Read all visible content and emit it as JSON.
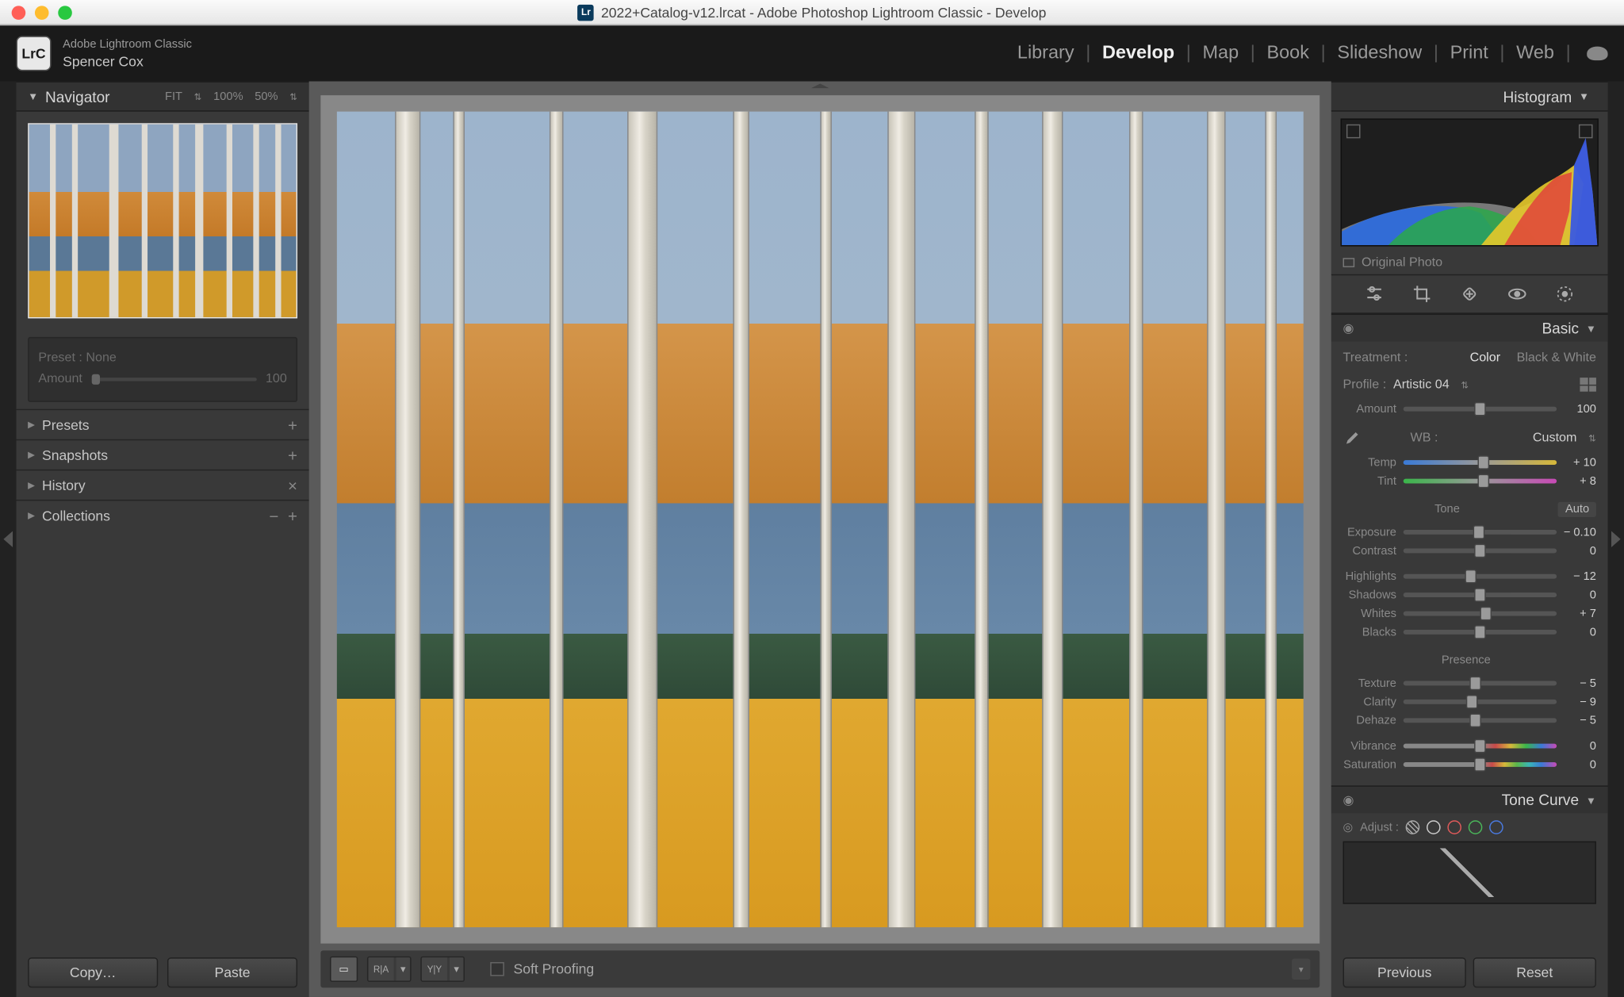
{
  "window": {
    "title": "2022+Catalog-v12.lrcat - Adobe Photoshop Lightroom Classic - Develop"
  },
  "header": {
    "app_name": "Adobe Lightroom Classic",
    "user_name": "Spencer Cox",
    "logo_text": "LrC",
    "modules": [
      "Library",
      "Develop",
      "Map",
      "Book",
      "Slideshow",
      "Print",
      "Web"
    ],
    "active_module": "Develop"
  },
  "left": {
    "navigator": {
      "title": "Navigator",
      "zoom_fit": "FIT",
      "zoom_100": "100%",
      "zoom_50": "50%"
    },
    "preset_box": {
      "preset_label": "Preset : None",
      "amount_label": "Amount",
      "amount_value": "100"
    },
    "sections": [
      {
        "label": "Presets",
        "actions": [
          "+"
        ]
      },
      {
        "label": "Snapshots",
        "actions": [
          "+"
        ]
      },
      {
        "label": "History",
        "actions": [
          "×"
        ]
      },
      {
        "label": "Collections",
        "actions": [
          "−",
          "+"
        ]
      }
    ],
    "copy_btn": "Copy…",
    "paste_btn": "Paste"
  },
  "center": {
    "view_single": "▢",
    "view_ref": "R|A",
    "view_before": "Y|Y",
    "soft_proof_label": "Soft Proofing"
  },
  "right": {
    "histogram": {
      "title": "Histogram",
      "original_label": "Original Photo"
    },
    "basic": {
      "title": "Basic",
      "treatment_label": "Treatment :",
      "treatment_color": "Color",
      "treatment_bw": "Black & White",
      "profile_label": "Profile :",
      "profile_value": "Artistic 04",
      "amount_label": "Amount",
      "amount_value": "100",
      "wb_label": "WB :",
      "wb_value": "Custom",
      "tone_label": "Tone",
      "auto_label": "Auto",
      "presence_label": "Presence",
      "sliders": {
        "temp": {
          "label": "Temp",
          "value": "+ 10",
          "pos": 52
        },
        "tint": {
          "label": "Tint",
          "value": "+ 8",
          "pos": 52
        },
        "exposure": {
          "label": "Exposure",
          "value": "− 0.10",
          "pos": 49
        },
        "contrast": {
          "label": "Contrast",
          "value": "0",
          "pos": 50
        },
        "highlights": {
          "label": "Highlights",
          "value": "− 12",
          "pos": 44
        },
        "shadows": {
          "label": "Shadows",
          "value": "0",
          "pos": 50
        },
        "whites": {
          "label": "Whites",
          "value": "+ 7",
          "pos": 54
        },
        "blacks": {
          "label": "Blacks",
          "value": "0",
          "pos": 50
        },
        "texture": {
          "label": "Texture",
          "value": "− 5",
          "pos": 47
        },
        "clarity": {
          "label": "Clarity",
          "value": "− 9",
          "pos": 45
        },
        "dehaze": {
          "label": "Dehaze",
          "value": "− 5",
          "pos": 47
        },
        "vibrance": {
          "label": "Vibrance",
          "value": "0",
          "pos": 50
        },
        "saturation": {
          "label": "Saturation",
          "value": "0",
          "pos": 50
        }
      }
    },
    "tone_curve": {
      "title": "Tone Curve",
      "adjust_label": "Adjust :"
    },
    "previous_btn": "Previous",
    "reset_btn": "Reset"
  }
}
